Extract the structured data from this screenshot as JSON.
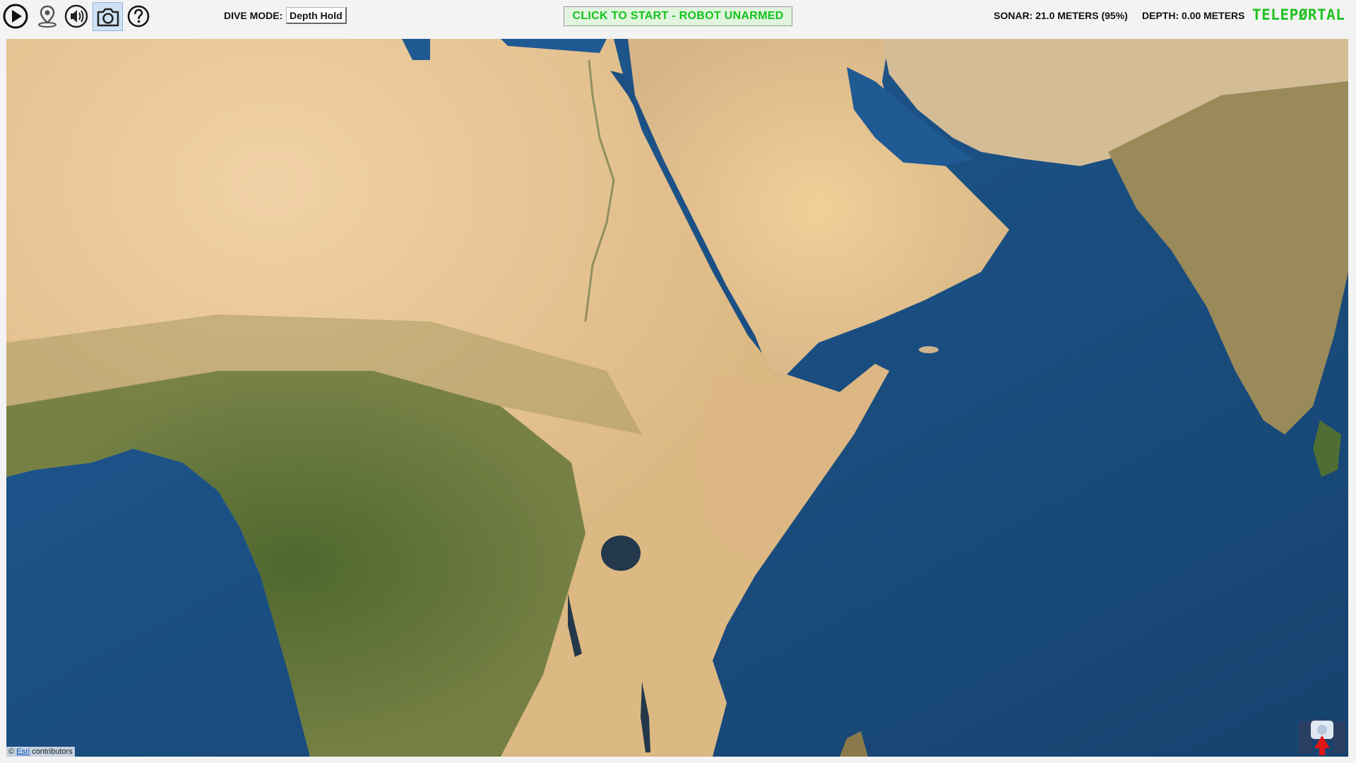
{
  "toolbar": {
    "icons": [
      "play-icon",
      "map-pin-icon",
      "speaker-icon",
      "camera-icon",
      "help-icon"
    ],
    "dive_mode_label": "DIVE MODE:",
    "dive_mode_value": "Depth Hold",
    "start_button": "CLICK TO START - ROBOT UNARMED",
    "sonar": "SONAR: 21.0 METERS (95%)",
    "depth": "DEPTH: 0.00 METERS",
    "logo": "TELEPØRTAL",
    "colors": {
      "start_text": "#12c41d",
      "start_bg": "#e1f4de",
      "logo": "#22c122",
      "active_icon_bg": "#cfe2f5"
    }
  },
  "map": {
    "attribution_prefix": "©",
    "attribution_link": "Esri",
    "attribution_suffix": "contributors",
    "overlay_icon": "robot-marker-icon"
  }
}
